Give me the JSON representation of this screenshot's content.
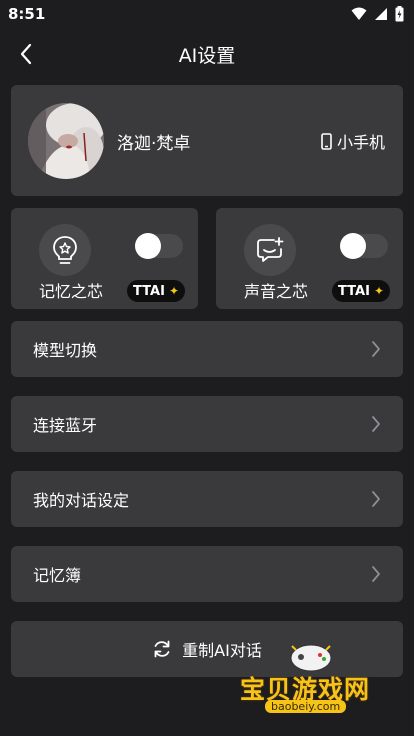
{
  "status_bar": {
    "time": "8:51"
  },
  "header": {
    "title": "AI设置"
  },
  "profile": {
    "name": "洛迦·梵卓",
    "device": "小手机"
  },
  "features": [
    {
      "label": "记忆之芯",
      "badge": "TTAI",
      "enabled": false,
      "icon": "memory-bulb-icon"
    },
    {
      "label": "声音之芯",
      "badge": "TTAI",
      "enabled": false,
      "icon": "voice-chat-icon"
    }
  ],
  "menu": [
    {
      "label": "模型切换"
    },
    {
      "label": "连接蓝牙"
    },
    {
      "label": "我的对话设定"
    },
    {
      "label": "记忆簿"
    }
  ],
  "reset": {
    "label": "重制AI对话"
  },
  "watermark": {
    "text": "宝贝游戏网",
    "url": "baobeiy.com"
  },
  "colors": {
    "background": "#1d1d1f",
    "card": "#3a3a3c",
    "badge_star": "#f5c518"
  }
}
